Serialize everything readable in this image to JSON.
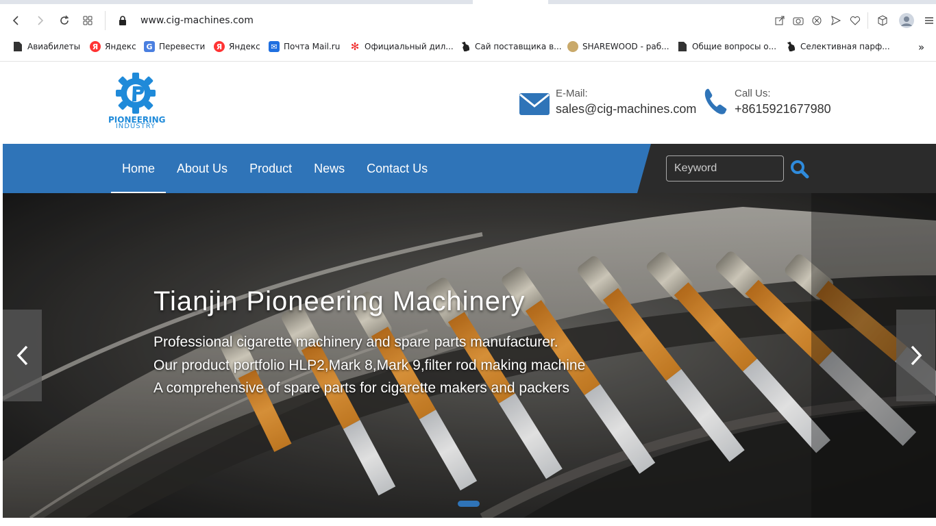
{
  "browser": {
    "url": "www.cig-machines.com",
    "bookmarks": [
      {
        "label": "Авиабилеты",
        "icon": "page-icon"
      },
      {
        "label": "Яндекс",
        "icon": "yandex-icon"
      },
      {
        "label": "Перевести",
        "icon": "translate-icon"
      },
      {
        "label": "Яндекс",
        "icon": "yandex-icon"
      },
      {
        "label": "Почта Mail.ru",
        "icon": "mail-icon"
      },
      {
        "label": "Официальный дил...",
        "icon": "huawei-icon"
      },
      {
        "label": "Сай поставщика в...",
        "icon": "bottle-icon"
      },
      {
        "label": "SHAREWOOD - раб...",
        "icon": "sharewood-icon"
      },
      {
        "label": "Общие вопросы о...",
        "icon": "page-icon"
      },
      {
        "label": "Селективная парф...",
        "icon": "bottle-icon"
      }
    ],
    "overflow": "»"
  },
  "header": {
    "logo_line1": "PIONEERING",
    "logo_line2": "INDUSTRY",
    "email_label": "E-Mail:",
    "email_value": "sales@cig-machines.com",
    "phone_label": "Call Us:",
    "phone_value": "+8615921677980"
  },
  "nav": {
    "items": [
      "Home",
      "About Us",
      "Product",
      "News",
      "Contact Us"
    ],
    "active": "Home",
    "search_placeholder": "Keyword"
  },
  "hero": {
    "title": "Tianjin Pioneering Machinery",
    "lines": [
      "Professional cigarette machinery and spare parts manufacturer.",
      "Our product portfolio HLP2,Mark 8,Mark 9,filter rod making machine",
      "A comprehensive of spare parts for cigarette makers and packers"
    ],
    "prev_arrow": "‹",
    "next_arrow": "›"
  },
  "colors": {
    "brand_blue": "#2f74b8",
    "nav_dark": "#2b2b2b",
    "logo_blue": "#1f8ad9"
  }
}
